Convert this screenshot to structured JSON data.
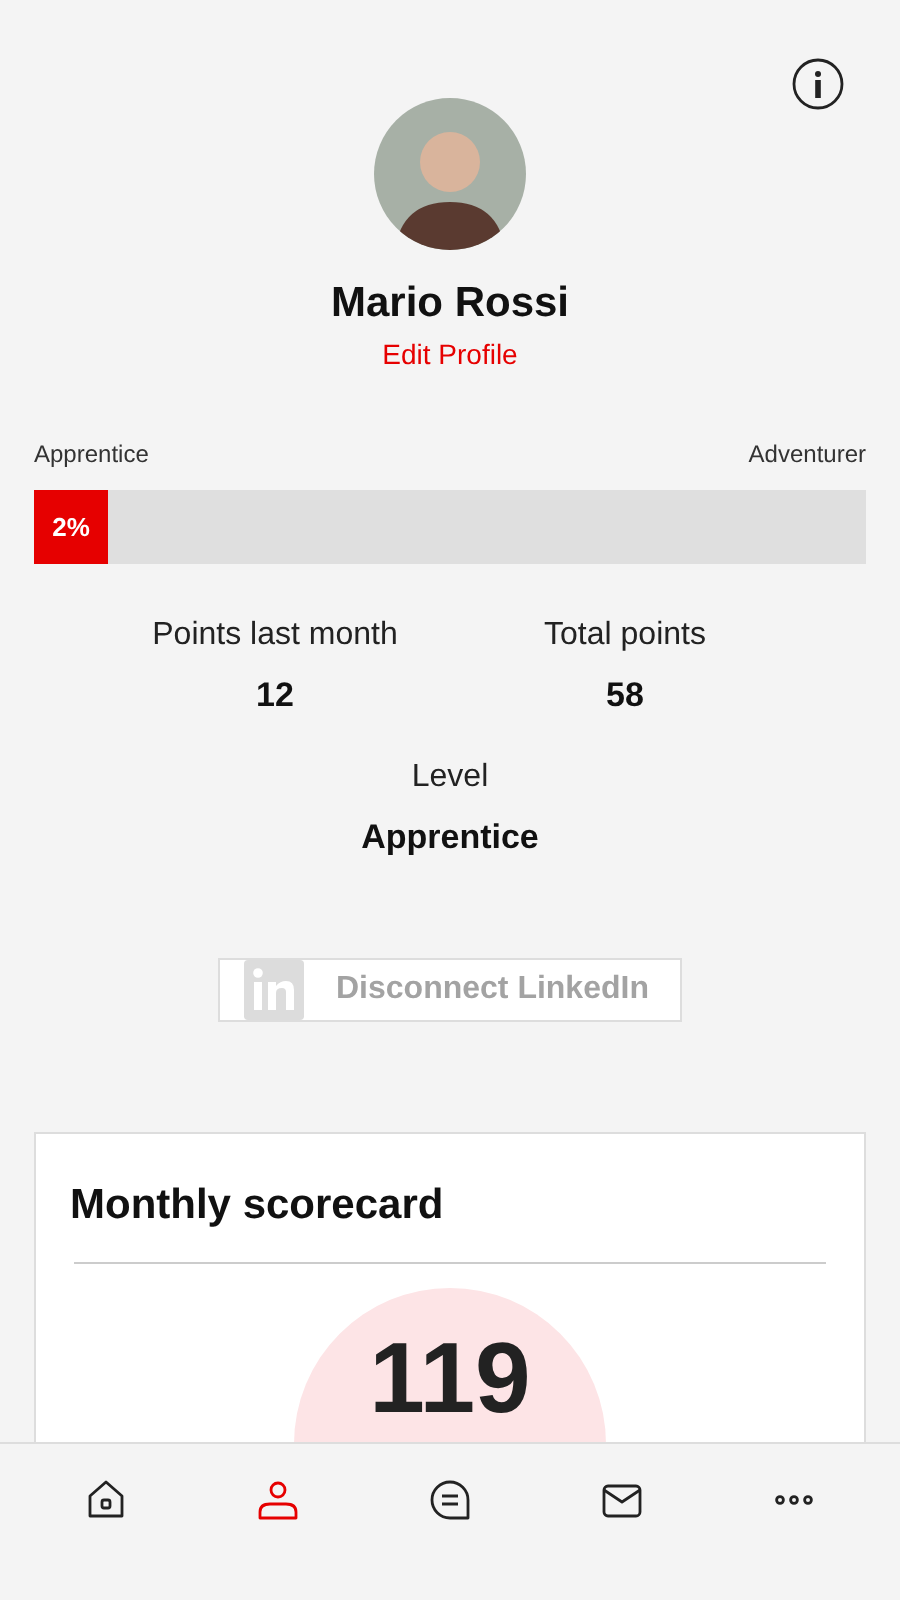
{
  "profile": {
    "name": "Mario Rossi",
    "edit_link": "Edit Profile"
  },
  "progress": {
    "current_level": "Apprentice",
    "next_level": "Adventurer",
    "level": 0.02,
    "reading": "2%"
  },
  "stats": [
    {
      "label": "Points last month",
      "value": "12"
    },
    {
      "label": "Total points",
      "value": "58"
    },
    {
      "label": "Level",
      "value": "Apprentice"
    }
  ],
  "linkedin_button": {
    "label": "Disconnect LinkedIn"
  },
  "scorecard": {
    "title": "Monthly scorecard",
    "score": "119"
  },
  "nav": [
    {
      "kind": "home",
      "selected": false
    },
    {
      "kind": "profile",
      "selected": true
    },
    {
      "kind": "chat",
      "selected": false
    },
    {
      "kind": "mail",
      "selected": false
    },
    {
      "kind": "more",
      "selected": false
    }
  ]
}
